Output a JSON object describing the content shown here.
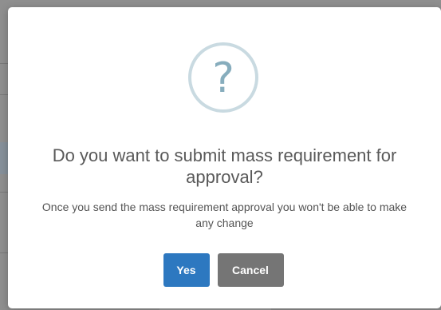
{
  "dialog": {
    "icon": "question-mark-icon",
    "icon_glyph": "?",
    "title": "Do you want to submit mass requirement for approval?",
    "message": "Once you send the mass requirement approval you won't be able to make any change",
    "buttons": {
      "confirm_label": "Yes",
      "cancel_label": "Cancel"
    }
  },
  "colors": {
    "confirm_button": "#2d78c0",
    "cancel_button": "#757575",
    "icon_ring": "#c9dae1",
    "icon_glyph": "#87adbd",
    "overlay": "#8c8c8c"
  }
}
